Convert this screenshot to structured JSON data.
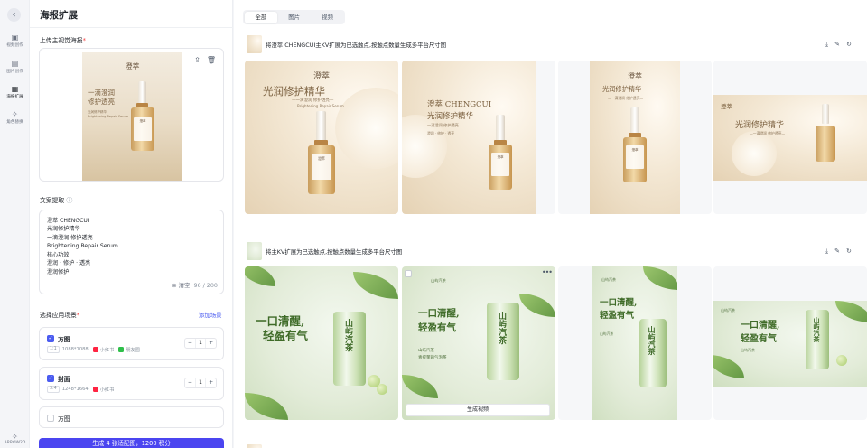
{
  "rail": {
    "items": [
      {
        "icon": "video-create-icon",
        "label": "视频创作"
      },
      {
        "icon": "image-create-icon",
        "label": "图片创作"
      },
      {
        "icon": "poster-expand-icon",
        "label": "海报扩展"
      },
      {
        "icon": "role-replace-icon",
        "label": "角色替换"
      }
    ],
    "bottom_label": "ARROW2D"
  },
  "panel": {
    "title": "海报扩展",
    "upload_label": "上传主视觉海报",
    "upload_preview": {
      "brand": "澄萃",
      "headline_1": "一滴澄润",
      "headline_2": "修护透亮",
      "sub_1": "光润修护精华",
      "sub_2": "Brightening Repair Serum",
      "bottle_label": "澄萃"
    },
    "copy_label": "文案提取",
    "copy_lines": [
      "澄萃 CHENGCUI",
      "光润修护精华",
      "一滴澄润 修护透亮",
      "Brightening Repair Serum",
      "核心功效",
      "澄润 · 修护 · 透亮",
      "澄润修护"
    ],
    "clear_label": "清空",
    "char_count": "96 / 200",
    "scene_label": "选择应用场景",
    "add_scene_label": "添加场景",
    "scenes": [
      {
        "name": "方图",
        "ratio": "1:1",
        "size": "1088*1088",
        "platforms": [
          "小红书",
          "朋友圈"
        ],
        "count": "1",
        "checked": true
      },
      {
        "name": "封面",
        "ratio": "3:4",
        "size": "1248*1664",
        "platforms": [
          "小红书"
        ],
        "count": "1",
        "checked": true
      },
      {
        "name": "方图",
        "checked": false
      }
    ],
    "generate_label": "生成 4 张适配图，1200 积分"
  },
  "main": {
    "tabs": [
      "全部",
      "图片",
      "视频"
    ],
    "tasks": [
      {
        "title": "将澄萃 CHENGCUI主KV扩展为已选触点,按触点数量生成多平台尺寸图",
        "poster": {
          "brand": "澄萃",
          "headline": "光润修护精华",
          "sub": "—一滴澄润 修护透亮—",
          "en": "Brightening Repair Serum",
          "alt_headline_1": "澄萃 CHENGCUI",
          "alt_headline_2": "光润修护精华",
          "alt_sub": "一滴澄润 修护透亮",
          "bottle_label": "澄萃",
          "tags": "澄润 · 修护 · 透亮"
        }
      },
      {
        "title": "将主KV扩展为已选触点,按触点数量生成多平台尺寸图",
        "poster": {
          "brand": "山屿汽茶",
          "headline_1": "一口清醒,",
          "headline_2": "轻盈有气",
          "can_text": "山屿汽茶",
          "sub_1": "山屿汽茶",
          "sub_2": "青提茉莉气泡茶"
        },
        "video_label": "生成视频"
      }
    ]
  },
  "colors": {
    "accent": "#4b45f0",
    "link": "#4b5cf0",
    "required": "#f53f3f",
    "xiaohongshu": "#ff2442",
    "wechat_moments": "#2fbf4a"
  }
}
